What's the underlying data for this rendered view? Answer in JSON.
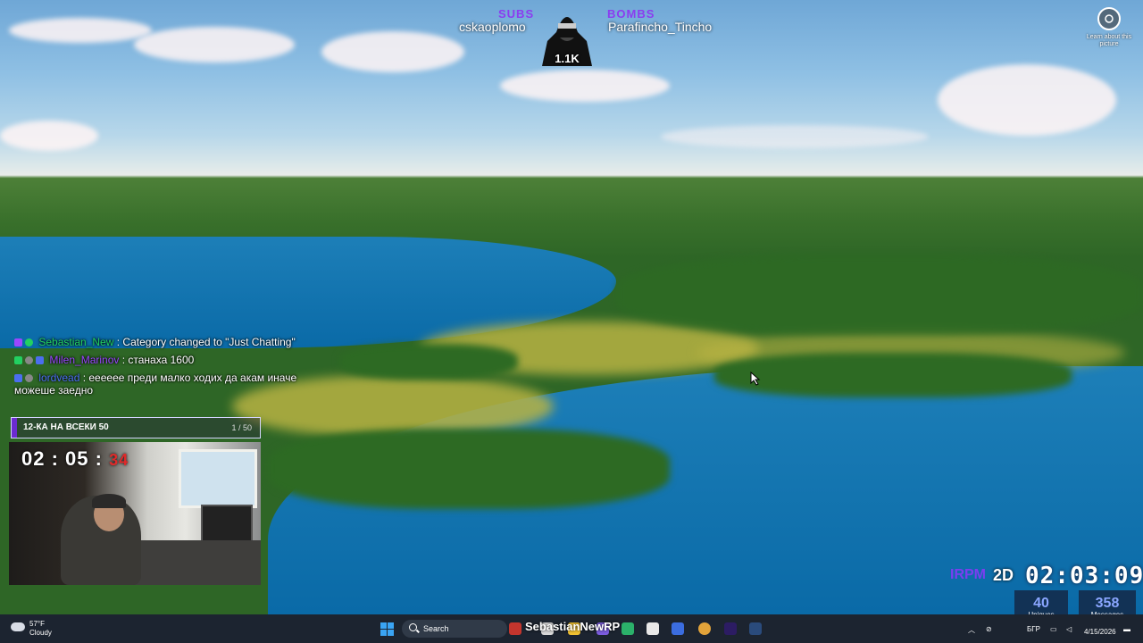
{
  "overlay": {
    "subs_label": "SUBS",
    "subs_value": "cskaoplomo",
    "bombs_label": "BOMBS",
    "bombs_value": "Parafincho_Tincho",
    "mascot_count": "1.1K"
  },
  "learn_picture": {
    "label": "Learn about this picture",
    "icon": "camera-icon"
  },
  "chat": {
    "messages": [
      {
        "user": "Sebastian_New",
        "text": ": Category changed to \"Just Chatting\""
      },
      {
        "user": "Milen_Marinov",
        "text": ": станаха 1600"
      },
      {
        "user": "lordvead",
        "text": ": ееееее преди малко ходих да акам иначе можеше заедно"
      }
    ]
  },
  "goal": {
    "label": "12-КА НА ВСЕКИ 50",
    "progress_text": "1 / 50",
    "progress": 0.02,
    "color": "#6b2bd0"
  },
  "webcam": {
    "timer_main": "02 : 05 :",
    "timer_sec": "34"
  },
  "stream_timer": {
    "prefix": "IRPM",
    "days": "2D",
    "time": "02:03:09"
  },
  "stats": {
    "uniques": {
      "value": "40",
      "label": "Uniques"
    },
    "messages": {
      "value": "358",
      "label": "Messages"
    }
  },
  "taskbar": {
    "weather_temp": "57°F",
    "weather_desc": "Cloudy",
    "search_placeholder": "Search",
    "overlay_name": "SebastianNewRP",
    "lang": "БГР",
    "date": "4/15/2026"
  },
  "colors": {
    "accent": "#8b3cf0",
    "taskbar": "#1c2430",
    "start": "#3aa4f3"
  }
}
